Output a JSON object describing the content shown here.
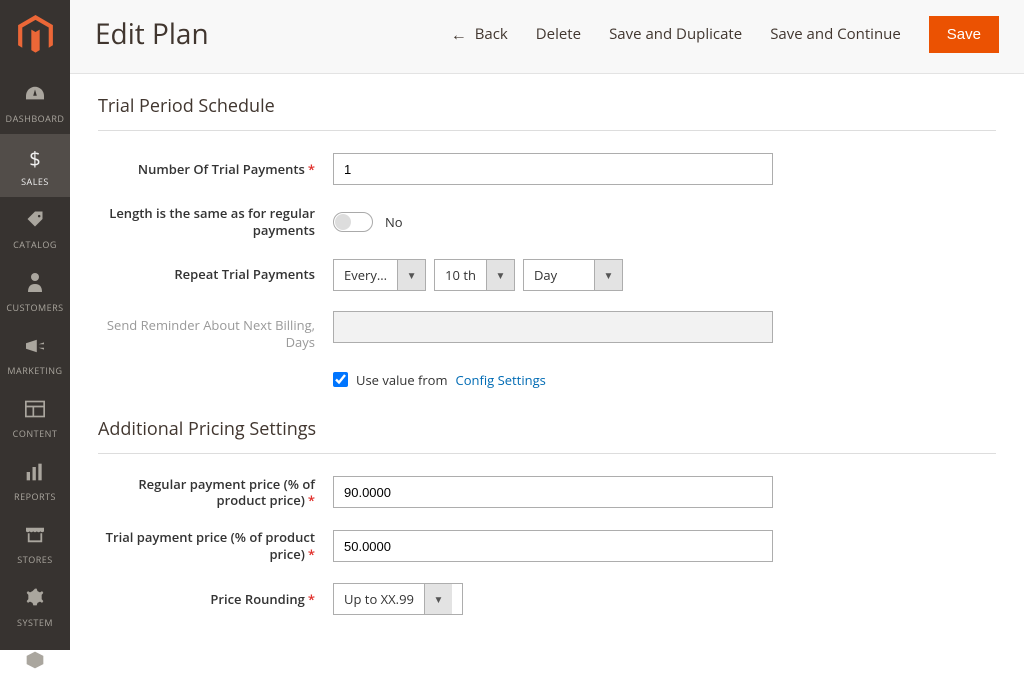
{
  "sidebar": {
    "items": [
      {
        "label": "DASHBOARD"
      },
      {
        "label": "SALES"
      },
      {
        "label": "CATALOG"
      },
      {
        "label": "CUSTOMERS"
      },
      {
        "label": "MARKETING"
      },
      {
        "label": "CONTENT"
      },
      {
        "label": "REPORTS"
      },
      {
        "label": "STORES"
      },
      {
        "label": "SYSTEM"
      }
    ]
  },
  "header": {
    "title": "Edit Plan",
    "back": "Back",
    "delete": "Delete",
    "save_duplicate": "Save and Duplicate",
    "save_continue": "Save and Continue",
    "save": "Save"
  },
  "sections": {
    "trial": {
      "title": "Trial Period Schedule",
      "num_payments_label": "Number Of Trial Payments",
      "num_payments_value": "1",
      "length_same_label": "Length is the same as for regular payments",
      "length_same_value": "No",
      "repeat_label": "Repeat Trial Payments",
      "repeat_every": "Every...",
      "repeat_ordinal": "10 th",
      "repeat_unit": "Day",
      "reminder_label": "Send Reminder About Next Billing, Days",
      "use_value_text": "Use value from",
      "config_link": "Config Settings"
    },
    "pricing": {
      "title": "Additional Pricing Settings",
      "regular_price_label": "Regular payment price (% of product price)",
      "regular_price_value": "90.0000",
      "trial_price_label": "Trial payment price (% of product price)",
      "trial_price_value": "50.0000",
      "rounding_label": "Price Rounding",
      "rounding_value": "Up to XX.99"
    }
  }
}
